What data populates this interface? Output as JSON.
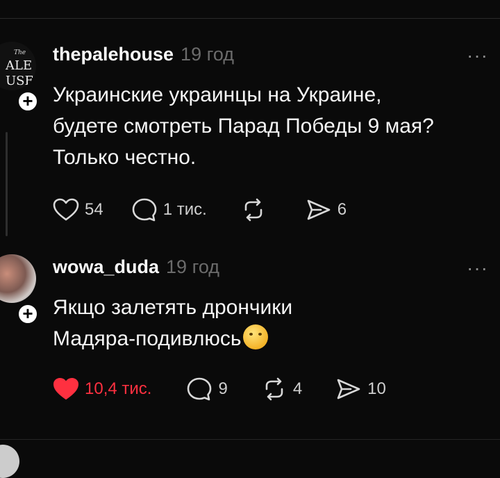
{
  "posts": [
    {
      "username": "thepalehouse",
      "time": "19 год",
      "lines": [
        "Украинские украинцы на Украине,",
        "будете смотреть Парад Победы 9 мая?",
        "Только честно."
      ],
      "likes": "54",
      "comments": "1 тис.",
      "reposts": "",
      "shares": "6",
      "liked": false
    },
    {
      "username": "wowa_duda",
      "time": "19 год",
      "lines": [
        "Якщо залетять дрончики",
        "Мадяра-подивлюсь"
      ],
      "likes": "10,4 тис.",
      "comments": "9",
      "reposts": "4",
      "shares": "10",
      "liked": true
    }
  ],
  "avatar1_logo": [
    "The",
    "ALE",
    "USE"
  ],
  "more_label": "···",
  "colors": {
    "like_red": "#ff3040",
    "bg": "#0a0a0a",
    "muted": "#6b6b6b"
  }
}
